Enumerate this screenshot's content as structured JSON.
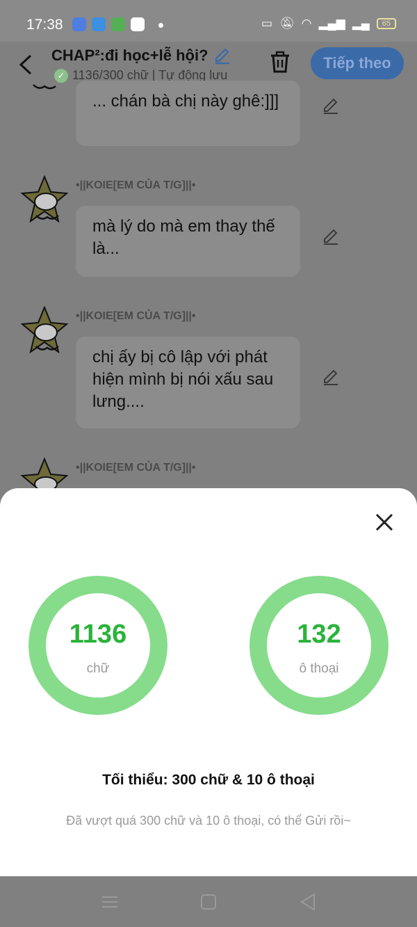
{
  "status_bar": {
    "time": "17:38",
    "battery": "65",
    "notification_icons": [
      "app-icon",
      "messenger-icon",
      "app-icon",
      "facebook-icon"
    ]
  },
  "header": {
    "title": "CHAP²:đi học+lễ hội?",
    "subtitle": "1136/300 chữ | Tự động lưu",
    "next_label": "Tiếp theo"
  },
  "messages": [
    {
      "sender": "",
      "text": "... chán bà chị này ghê:]]]"
    },
    {
      "sender": "•||KOIE[EM CỦA T/G]||•",
      "text": "mà lý do mà em thay thế là..."
    },
    {
      "sender": "•||KOIE[EM CỦA T/G]||•",
      "text": "chị ấy bị cô lập với phát hiện mình bị nói xấu sau lưng...."
    },
    {
      "sender": "•||KOIE[EM CỦA T/G]||•",
      "text": ""
    }
  ],
  "stats_sheet": {
    "word_count": "1136",
    "word_unit": "chữ",
    "dialog_count": "132",
    "dialog_unit": "ô thoại",
    "minimum": "Tối thiểu: 300 chữ & 10 ô thoại",
    "note": "Đã vượt quá 300 chữ và 10 ô thoại, có thể Gửi rồi~"
  },
  "colors": {
    "ring": "#86dc8b",
    "count_text": "#2ab33a",
    "next_button": "#3b6aa8"
  }
}
